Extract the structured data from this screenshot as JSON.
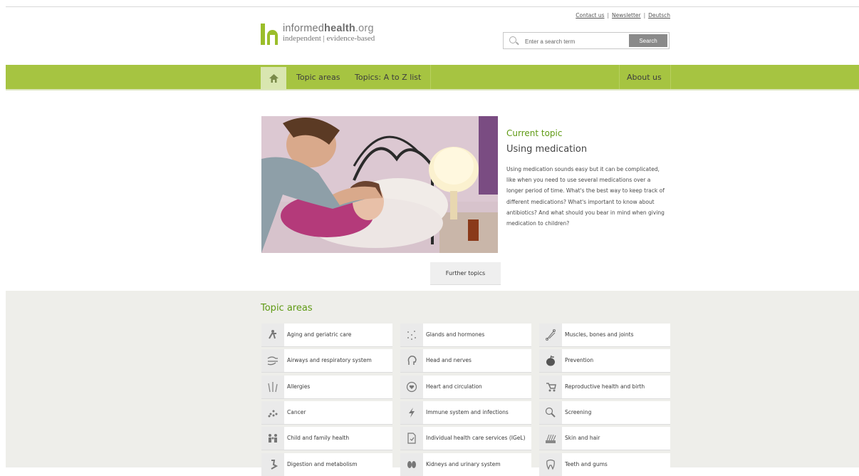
{
  "header": {
    "logo_name_light": "informed",
    "logo_name_bold": "health",
    "logo_name_suffix": ".org",
    "logo_tagline": "independent | evidence-based",
    "top_links": [
      "Contact us",
      "Newsletter",
      "Deutsch"
    ],
    "search_placeholder": "Enter a search term",
    "search_button": "Search"
  },
  "nav": {
    "home_icon": "home-icon",
    "items": [
      "Topic areas",
      "Topics: A to Z list"
    ],
    "right_item": "About us"
  },
  "hero": {
    "label": "Current topic",
    "title": "Using medication",
    "description": "Using medication sounds easy but it can be complicated, like when you need to use several medications over a longer period of time. What's the best way to keep track of different medications? What's important to know about antibiotics? And what should you bear in mind when giving medication to children?",
    "further_button": "Further topics"
  },
  "topic_areas": {
    "title": "Topic areas",
    "columns": [
      [
        {
          "label": "Aging and geriatric care",
          "icon": "walking-cane-icon"
        },
        {
          "label": "Airways and respiratory system",
          "icon": "wind-icon"
        },
        {
          "label": "Allergies",
          "icon": "grass-icon"
        },
        {
          "label": "Cancer",
          "icon": "cells-icon"
        },
        {
          "label": "Child and family health",
          "icon": "family-icon"
        },
        {
          "label": "Digestion and metabolism",
          "icon": "digestion-icon"
        }
      ],
      [
        {
          "label": "Glands and hormones",
          "icon": "dots-icon"
        },
        {
          "label": "Head and nerves",
          "icon": "head-icon"
        },
        {
          "label": "Heart and circulation",
          "icon": "heart-icon"
        },
        {
          "label": "Immune system and infections",
          "icon": "lightning-icon"
        },
        {
          "label": "Individual health care services (IGeL)",
          "icon": "document-icon"
        },
        {
          "label": "Kidneys and urinary system",
          "icon": "kidneys-icon"
        }
      ],
      [
        {
          "label": "Muscles, bones and joints",
          "icon": "bone-icon"
        },
        {
          "label": "Prevention",
          "icon": "apple-icon"
        },
        {
          "label": "Reproductive health and birth",
          "icon": "stroller-icon"
        },
        {
          "label": "Screening",
          "icon": "magnifier-icon"
        },
        {
          "label": "Skin and hair",
          "icon": "skin-hair-icon"
        },
        {
          "label": "Teeth and gums",
          "icon": "tooth-icon"
        }
      ]
    ]
  }
}
